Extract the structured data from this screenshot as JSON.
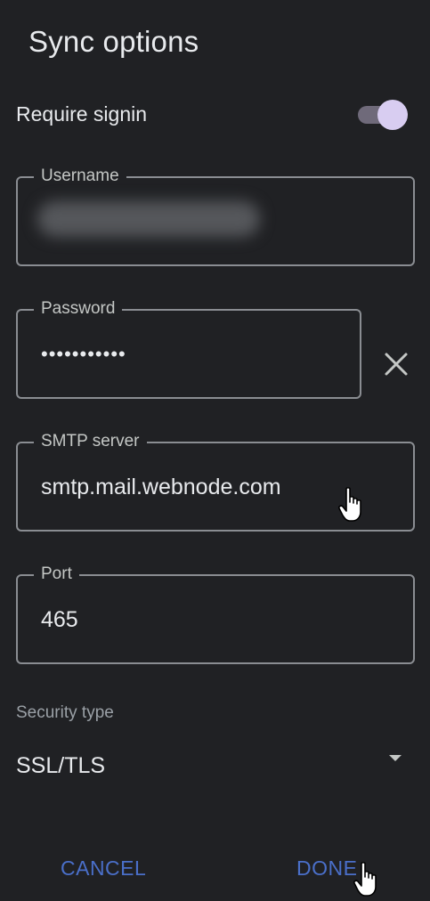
{
  "title": "Sync options",
  "require_signin": {
    "label": "Require signin",
    "enabled": true
  },
  "fields": {
    "username": {
      "label": "Username",
      "value": ""
    },
    "password": {
      "label": "Password",
      "value": "•••••••••••"
    },
    "smtp": {
      "label": "SMTP server",
      "value": "smtp.mail.webnode.com"
    },
    "port": {
      "label": "Port",
      "value": "465"
    }
  },
  "security": {
    "label": "Security type",
    "value": "SSL/TLS"
  },
  "actions": {
    "cancel": "CANCEL",
    "done": "DONE"
  },
  "icons": {
    "clear": "close-icon",
    "dropdown": "dropdown-arrow-icon",
    "cursor": "hand-cursor-icon"
  },
  "colors": {
    "background": "#202124",
    "accent": "#4a6fc9",
    "toggle_thumb": "#d8cdf1",
    "outline": "#8a8d92"
  }
}
